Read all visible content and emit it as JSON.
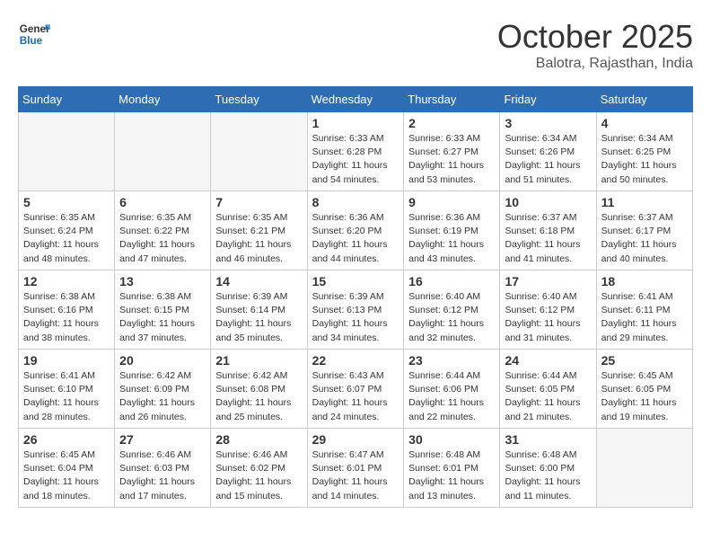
{
  "header": {
    "logo_line1": "General",
    "logo_line2": "Blue",
    "month": "October 2025",
    "location": "Balotra, Rajasthan, India"
  },
  "weekdays": [
    "Sunday",
    "Monday",
    "Tuesday",
    "Wednesday",
    "Thursday",
    "Friday",
    "Saturday"
  ],
  "weeks": [
    [
      {
        "day": "",
        "info": ""
      },
      {
        "day": "",
        "info": ""
      },
      {
        "day": "",
        "info": ""
      },
      {
        "day": "1",
        "info": "Sunrise: 6:33 AM\nSunset: 6:28 PM\nDaylight: 11 hours\nand 54 minutes."
      },
      {
        "day": "2",
        "info": "Sunrise: 6:33 AM\nSunset: 6:27 PM\nDaylight: 11 hours\nand 53 minutes."
      },
      {
        "day": "3",
        "info": "Sunrise: 6:34 AM\nSunset: 6:26 PM\nDaylight: 11 hours\nand 51 minutes."
      },
      {
        "day": "4",
        "info": "Sunrise: 6:34 AM\nSunset: 6:25 PM\nDaylight: 11 hours\nand 50 minutes."
      }
    ],
    [
      {
        "day": "5",
        "info": "Sunrise: 6:35 AM\nSunset: 6:24 PM\nDaylight: 11 hours\nand 48 minutes."
      },
      {
        "day": "6",
        "info": "Sunrise: 6:35 AM\nSunset: 6:22 PM\nDaylight: 11 hours\nand 47 minutes."
      },
      {
        "day": "7",
        "info": "Sunrise: 6:35 AM\nSunset: 6:21 PM\nDaylight: 11 hours\nand 46 minutes."
      },
      {
        "day": "8",
        "info": "Sunrise: 6:36 AM\nSunset: 6:20 PM\nDaylight: 11 hours\nand 44 minutes."
      },
      {
        "day": "9",
        "info": "Sunrise: 6:36 AM\nSunset: 6:19 PM\nDaylight: 11 hours\nand 43 minutes."
      },
      {
        "day": "10",
        "info": "Sunrise: 6:37 AM\nSunset: 6:18 PM\nDaylight: 11 hours\nand 41 minutes."
      },
      {
        "day": "11",
        "info": "Sunrise: 6:37 AM\nSunset: 6:17 PM\nDaylight: 11 hours\nand 40 minutes."
      }
    ],
    [
      {
        "day": "12",
        "info": "Sunrise: 6:38 AM\nSunset: 6:16 PM\nDaylight: 11 hours\nand 38 minutes."
      },
      {
        "day": "13",
        "info": "Sunrise: 6:38 AM\nSunset: 6:15 PM\nDaylight: 11 hours\nand 37 minutes."
      },
      {
        "day": "14",
        "info": "Sunrise: 6:39 AM\nSunset: 6:14 PM\nDaylight: 11 hours\nand 35 minutes."
      },
      {
        "day": "15",
        "info": "Sunrise: 6:39 AM\nSunset: 6:13 PM\nDaylight: 11 hours\nand 34 minutes."
      },
      {
        "day": "16",
        "info": "Sunrise: 6:40 AM\nSunset: 6:12 PM\nDaylight: 11 hours\nand 32 minutes."
      },
      {
        "day": "17",
        "info": "Sunrise: 6:40 AM\nSunset: 6:12 PM\nDaylight: 11 hours\nand 31 minutes."
      },
      {
        "day": "18",
        "info": "Sunrise: 6:41 AM\nSunset: 6:11 PM\nDaylight: 11 hours\nand 29 minutes."
      }
    ],
    [
      {
        "day": "19",
        "info": "Sunrise: 6:41 AM\nSunset: 6:10 PM\nDaylight: 11 hours\nand 28 minutes."
      },
      {
        "day": "20",
        "info": "Sunrise: 6:42 AM\nSunset: 6:09 PM\nDaylight: 11 hours\nand 26 minutes."
      },
      {
        "day": "21",
        "info": "Sunrise: 6:42 AM\nSunset: 6:08 PM\nDaylight: 11 hours\nand 25 minutes."
      },
      {
        "day": "22",
        "info": "Sunrise: 6:43 AM\nSunset: 6:07 PM\nDaylight: 11 hours\nand 24 minutes."
      },
      {
        "day": "23",
        "info": "Sunrise: 6:44 AM\nSunset: 6:06 PM\nDaylight: 11 hours\nand 22 minutes."
      },
      {
        "day": "24",
        "info": "Sunrise: 6:44 AM\nSunset: 6:05 PM\nDaylight: 11 hours\nand 21 minutes."
      },
      {
        "day": "25",
        "info": "Sunrise: 6:45 AM\nSunset: 6:05 PM\nDaylight: 11 hours\nand 19 minutes."
      }
    ],
    [
      {
        "day": "26",
        "info": "Sunrise: 6:45 AM\nSunset: 6:04 PM\nDaylight: 11 hours\nand 18 minutes."
      },
      {
        "day": "27",
        "info": "Sunrise: 6:46 AM\nSunset: 6:03 PM\nDaylight: 11 hours\nand 17 minutes."
      },
      {
        "day": "28",
        "info": "Sunrise: 6:46 AM\nSunset: 6:02 PM\nDaylight: 11 hours\nand 15 minutes."
      },
      {
        "day": "29",
        "info": "Sunrise: 6:47 AM\nSunset: 6:01 PM\nDaylight: 11 hours\nand 14 minutes."
      },
      {
        "day": "30",
        "info": "Sunrise: 6:48 AM\nSunset: 6:01 PM\nDaylight: 11 hours\nand 13 minutes."
      },
      {
        "day": "31",
        "info": "Sunrise: 6:48 AM\nSunset: 6:00 PM\nDaylight: 11 hours\nand 11 minutes."
      },
      {
        "day": "",
        "info": ""
      }
    ]
  ]
}
